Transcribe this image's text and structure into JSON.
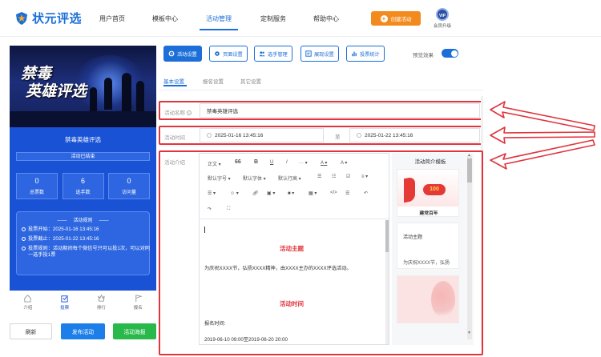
{
  "brand": {
    "logo_text": "状元评选",
    "accent": "#1c6fd8",
    "logo_icon": "shield-star-icon"
  },
  "nav": {
    "items": [
      "用户首页",
      "模板中心",
      "活动管理",
      "定制服务",
      "帮助中心"
    ],
    "active_index": 2
  },
  "header": {
    "create_label": "创建活动",
    "vip_badge": "VIP",
    "vip_label": "会员升级"
  },
  "preview": {
    "banner_line1": "禁毒",
    "banner_line2": "英雄评选",
    "title": "禁毒英雄评选",
    "status": "活动已结束",
    "stats": [
      {
        "value": "0",
        "label": "总票数"
      },
      {
        "value": "6",
        "label": "选手数"
      },
      {
        "value": "0",
        "label": "访问量"
      }
    ],
    "rules_title": "活动规则",
    "rules": [
      "投票开始：2025-01-16 13:45:16",
      "投票截止：2025-01-22 13:45:16",
      "投票规则：活动期间每个微信号只可以投1次，可以对同一选手投1票"
    ],
    "tabs": [
      {
        "label": "介绍",
        "icon": "home-icon"
      },
      {
        "label": "投票",
        "icon": "vote-icon"
      },
      {
        "label": "排行",
        "icon": "rank-icon"
      },
      {
        "label": "报名",
        "icon": "flag-icon"
      }
    ],
    "active_tab": 1
  },
  "bottom_buttons": {
    "refresh": "刷新",
    "publish": "发布活动",
    "poster": "活动海报"
  },
  "toolbar": [
    {
      "label": "活动设置",
      "icon": "gear-icon"
    },
    {
      "label": "页面设置",
      "icon": "settings-icon"
    },
    {
      "label": "选手管理",
      "icon": "users-icon"
    },
    {
      "label": "展现设置",
      "icon": "layout-icon"
    },
    {
      "label": "投票统计",
      "icon": "chart-icon"
    }
  ],
  "preview_toggle": {
    "label": "预览效果",
    "on": true
  },
  "subtabs": [
    "基本设置",
    "报名设置",
    "其它设置"
  ],
  "form": {
    "name_label": "活动名称",
    "name_value": "禁毒英雄评选",
    "time_label": "活动时间",
    "start": "2025-01-16 13:45:16",
    "separator": "至",
    "end": "2025-01-22 13:45:16",
    "intro_label": "活动介绍"
  },
  "editor": {
    "row1": [
      "正文",
      "66",
      "B",
      "U",
      "I",
      "···",
      "A",
      "A"
    ],
    "row2": [
      "默认字号",
      "默认字体",
      "默认行高"
    ],
    "content_title1": "活动主题",
    "content_text1": "为庆祝XXXX节，弘扬XXXX精神，由XXXX主办的XXXX评选活动。",
    "content_title2": "活动时间",
    "content_text2": "报名时间:",
    "content_text3": "2019-06-10 09:00至2019-06-20 20:00"
  },
  "templates": {
    "title": "活动简介模板",
    "card1_caption": "建党百年",
    "card1_badge": "100",
    "card2_title": "活动主题",
    "card2_text": "为庆祝XXXX节，弘扬"
  }
}
